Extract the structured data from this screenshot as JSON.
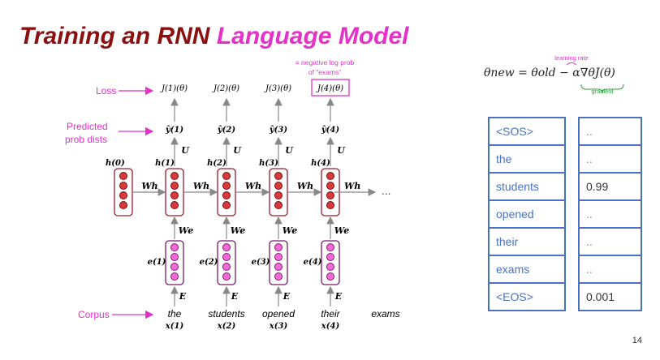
{
  "slide": {
    "title_part1": "Training an RNN",
    "title_part2": "Language Model",
    "slide_number": "14"
  },
  "colors": {
    "title_dark": "#8b1010",
    "accent_pink": "#e431c8",
    "rnn_red": "#9b1c2a",
    "table_blue": "#4a72c4",
    "green": "#2e9e3e"
  },
  "diagram": {
    "side_labels": {
      "loss": "Loss",
      "predicted_1": "Predicted",
      "predicted_2": "prob dists",
      "corpus": "Corpus"
    },
    "annotation_1": "= negative log prob",
    "annotation_2": "of “exams”",
    "ellipsis": "...",
    "timesteps": [
      {
        "loss": "J(1)(θ)",
        "yhat": "ŷ(1)",
        "hidden": "h(1)",
        "embed": "e(1)",
        "word": "the",
        "x": "x(1)"
      },
      {
        "loss": "J(2)(θ)",
        "yhat": "ŷ(2)",
        "hidden": "h(2)",
        "embed": "e(2)",
        "word": "students",
        "x": "x(2)"
      },
      {
        "loss": "J(3)(θ)",
        "yhat": "ŷ(3)",
        "hidden": "h(3)",
        "embed": "e(3)",
        "word": "opened",
        "x": "x(3)"
      },
      {
        "loss": "J(4)(θ)",
        "yhat": "ŷ(4)",
        "hidden": "h(4)",
        "embed": "e(4)",
        "word": "their",
        "x": "x(4)"
      }
    ],
    "h0": "h(0)",
    "final_word": "exams",
    "weights": {
      "U": "U",
      "Wh": "Wh",
      "We": "We",
      "E": "E"
    }
  },
  "formula": {
    "text": "θnew = θold − α∇θJ(θ)",
    "learning_rate_label": "learning rate",
    "gradient_label": "gradient"
  },
  "table": {
    "rows": [
      {
        "token": "<SOS>",
        "prob": ".."
      },
      {
        "token": "the",
        "prob": ".."
      },
      {
        "token": "students",
        "prob": "0.99"
      },
      {
        "token": "opened",
        "prob": ".."
      },
      {
        "token": "their",
        "prob": ".."
      },
      {
        "token": "exams",
        "prob": ".."
      },
      {
        "token": "<EOS>",
        "prob": "0.001"
      }
    ]
  }
}
